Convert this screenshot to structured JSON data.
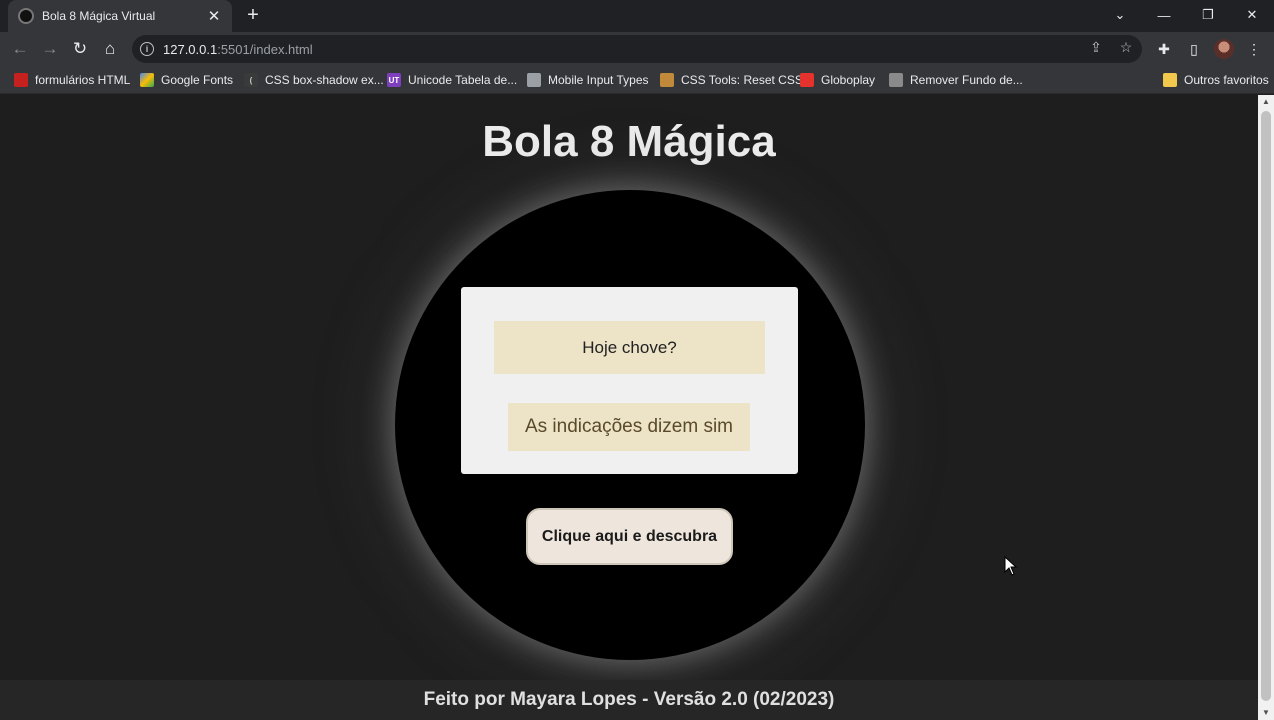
{
  "browser": {
    "tab_title": "Bola 8 Mágica Virtual",
    "url_host": "127.0.0.1",
    "url_path": ":5501/index.html",
    "bookmarks": [
      {
        "label": "formulários HTML",
        "icon_color": "#c5221f"
      },
      {
        "label": "Google Fonts",
        "icon_color": "#4285f4"
      },
      {
        "label": "CSS box-shadow ex...",
        "icon_color": "#555555"
      },
      {
        "label": "Unicode Tabela de...",
        "icon_color": "#7e3fbf"
      },
      {
        "label": "Mobile Input Types",
        "icon_color": "#9aa0a6"
      },
      {
        "label": "CSS Tools: Reset CSS",
        "icon_color": "#c08a3a"
      },
      {
        "label": "Globoplay",
        "icon_color": "#e5322d"
      },
      {
        "label": "Remover Fundo de...",
        "icon_color": "#8a8a8a"
      }
    ],
    "other_bookmarks": "Outros favoritos"
  },
  "page": {
    "title": "Bola 8 Mágica",
    "question_value": "Hoje chove?",
    "answer": "As indicações dizem sim",
    "button_label": "Clique aqui e descubra",
    "footer": "Feito por Mayara Lopes - Versão 2.0 (02/2023)"
  },
  "colors": {
    "background": "#1e1e1e",
    "ball": "#000000",
    "answer_window": "#f0f0f0",
    "field": "#ede3c7",
    "button": "#eee6dc"
  }
}
